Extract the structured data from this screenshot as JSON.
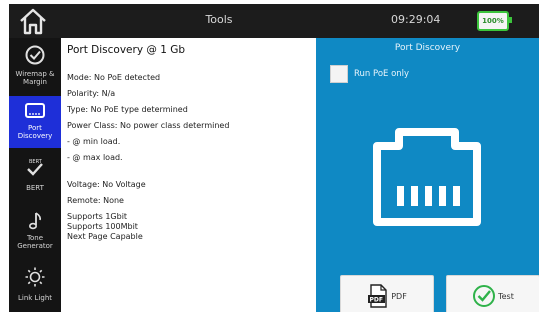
{
  "topbar": {
    "title": "Tools",
    "time": "09:29:04",
    "battery": "100%"
  },
  "sidebar": {
    "items": [
      {
        "label": "Wiremap & Margin",
        "icon": "check-circle-icon"
      },
      {
        "label": "Port Discovery",
        "icon": "ethernet-port-icon",
        "active": true
      },
      {
        "label": "BERT",
        "icon": "bert-icon"
      },
      {
        "label": "Tone Generator",
        "icon": "music-note-icon"
      },
      {
        "label": "Link Light",
        "icon": "sun-icon"
      }
    ]
  },
  "content": {
    "title": "Port Discovery @ 1 Gb",
    "lines": [
      "Mode: No PoE detected",
      "Polarity: N/a",
      "Type: No PoE type determined",
      "Power Class: No power class determined",
      "- @ min load.",
      "- @ max load.",
      "Voltage: No Voltage",
      "Remote: None",
      "Supports 1Gbit",
      "Supports 100Mbit",
      "Next Page Capable"
    ]
  },
  "panel": {
    "title": "Port Discovery",
    "run_poe_label": "Run PoE only",
    "pdf_label": "PDF",
    "pdf_icon_text": "PDF",
    "test_label": "Test"
  },
  "colors": {
    "panel_blue": "#0f89c4",
    "active_blue": "#1e2fd8",
    "battery_green": "#3cc43c",
    "test_green": "#2fb24a"
  }
}
